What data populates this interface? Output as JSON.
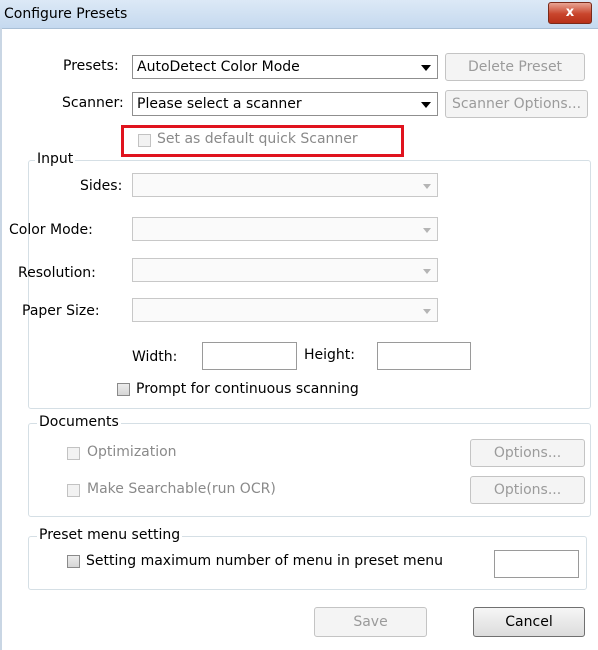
{
  "window": {
    "title": "Configure Presets",
    "close_glyph": "x"
  },
  "presets": {
    "label": "Presets:",
    "selected": "AutoDetect Color Mode",
    "delete_button": "Delete Preset"
  },
  "scanner": {
    "label": "Scanner:",
    "selected": "Please select a scanner",
    "options_button": "Scanner Options...",
    "default_quick_label": "Set as default quick Scanner"
  },
  "input": {
    "legend": "Input",
    "sides_label": "Sides:",
    "color_mode_label": "Color Mode:",
    "resolution_label": "Resolution:",
    "paper_size_label": "Paper Size:",
    "width_label": "Width:",
    "height_label": "Height:",
    "continuous_label": "Prompt for continuous scanning"
  },
  "documents": {
    "legend": "Documents",
    "optimization_label": "Optimization",
    "searchable_label": "Make Searchable(run OCR)",
    "options_label": "Options..."
  },
  "preset_menu": {
    "legend": "Preset menu setting",
    "max_label": "Setting maximum number of menu in preset menu"
  },
  "footer": {
    "save_label": "Save",
    "cancel_label": "Cancel"
  },
  "colors": {
    "highlight": "#e0131e",
    "title_bar": "#c5d9ef",
    "close_button": "#c9452c"
  }
}
